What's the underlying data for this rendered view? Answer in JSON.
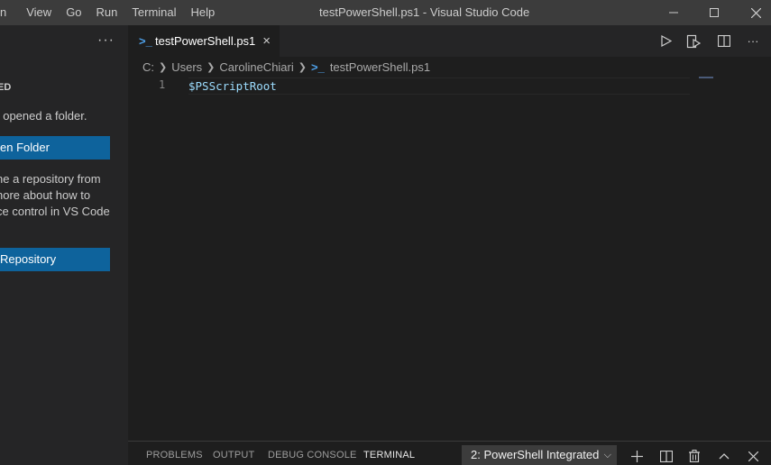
{
  "window": {
    "title": "testPowerShell.ps1 - Visual Studio Code",
    "menu": [
      "n",
      "View",
      "Go",
      "Run",
      "Terminal",
      "Help"
    ]
  },
  "sidebar": {
    "heading": "ED",
    "message_line": "t opened a folder.",
    "open_folder_label": "en Folder",
    "clone_text": [
      "ne a repository from",
      "nore about how to",
      "ce control in VS Code"
    ],
    "clone_button_label": "Repository"
  },
  "tab": {
    "label": "testPowerShell.ps1",
    "icon": "powershell-icon"
  },
  "breadcrumb": [
    "C:",
    "Users",
    "CarolineChiari",
    "testPowerShell.ps1"
  ],
  "editor": {
    "line_number": "1",
    "code": "$PSScriptRoot"
  },
  "panel": {
    "tabs": [
      "PROBLEMS",
      "OUTPUT",
      "DEBUG CONSOLE",
      "TERMINAL"
    ],
    "active_tab": "TERMINAL",
    "terminal_select": "2: PowerShell Integrated"
  }
}
